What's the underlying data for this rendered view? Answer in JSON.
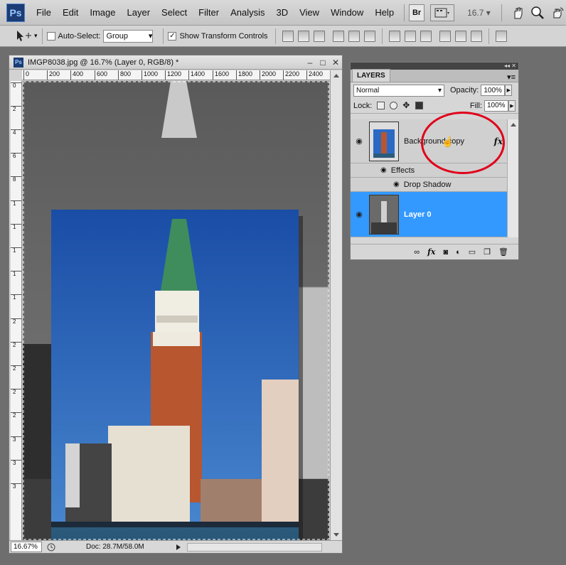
{
  "app": {
    "logo": "Ps",
    "menus": [
      "File",
      "Edit",
      "Image",
      "Layer",
      "Select",
      "Filter",
      "Analysis",
      "3D",
      "View",
      "Window",
      "Help"
    ],
    "bridge_label": "Br",
    "zoom_level": "16.7"
  },
  "options_bar": {
    "auto_select_label": "Auto-Select:",
    "auto_select_checked": false,
    "auto_select_value": "Group",
    "show_transform_label": "Show Transform Controls",
    "show_transform_checked": true
  },
  "document": {
    "title": "IMGP8038.jpg @ 16.7% (Layer 0, RGB/8) *",
    "ruler_h": [
      "0",
      "200",
      "400",
      "600",
      "800",
      "1000",
      "1200",
      "1400",
      "1600",
      "1800",
      "2000",
      "2200",
      "2400"
    ],
    "ruler_v": [
      "0",
      "2",
      "4",
      "6",
      "8",
      "1",
      "1",
      "1",
      "1",
      "1",
      "2",
      "2",
      "2",
      "2",
      "2",
      "3",
      "3",
      "3"
    ],
    "zoom_percent": "16.67%",
    "doc_info": "Doc: 28.7M/58.0M"
  },
  "layers_panel": {
    "tab_label": "LAYERS",
    "blend_mode": "Normal",
    "opacity_label": "Opacity:",
    "opacity_value": "100%",
    "lock_label": "Lock:",
    "fill_label": "Fill:",
    "fill_value": "100%",
    "layers": [
      {
        "name": "Background copy",
        "fx": "fx",
        "effects_label": "Effects",
        "effect": "Drop Shadow",
        "selected": false
      },
      {
        "name": "Layer 0",
        "selected": true
      }
    ]
  },
  "colors": {
    "selection_blue": "#3399ff",
    "annotation_red": "#e0001a"
  }
}
